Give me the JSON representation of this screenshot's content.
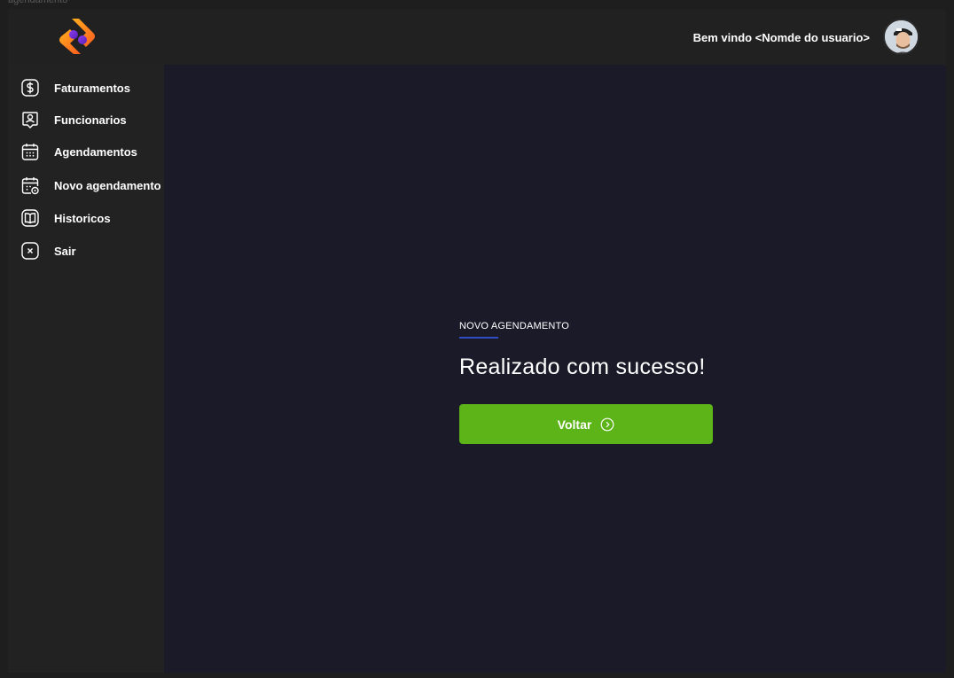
{
  "frame": {
    "label": "agendamento"
  },
  "header": {
    "welcome_text": "Bem vindo <Nomde do usuario>",
    "logo_icon": "brand-logo",
    "avatar_icon": "user-avatar"
  },
  "sidebar": {
    "items": [
      {
        "label": "Faturamentos",
        "icon": "dollar-icon"
      },
      {
        "label": "Funcionarios",
        "icon": "employee-badge-icon"
      },
      {
        "label": "Agendamentos",
        "icon": "calendar-icon"
      },
      {
        "label": "Novo agendamento",
        "icon": "calendar-add-icon"
      },
      {
        "label": "Historicos",
        "icon": "book-icon"
      },
      {
        "label": "Sair",
        "icon": "close-icon"
      }
    ]
  },
  "main": {
    "section_title": "NOVO AGENDAMENTO",
    "message": "Realizado com sucesso!",
    "button_label": "Voltar",
    "button_icon": "arrow-circle-right-icon"
  },
  "colors": {
    "page_bg": "#1e1e1e",
    "sidebar_bg": "#222222",
    "main_bg": "#1b1a29",
    "accent_underline": "#2f4cc2",
    "button_bg": "#5cb418"
  }
}
